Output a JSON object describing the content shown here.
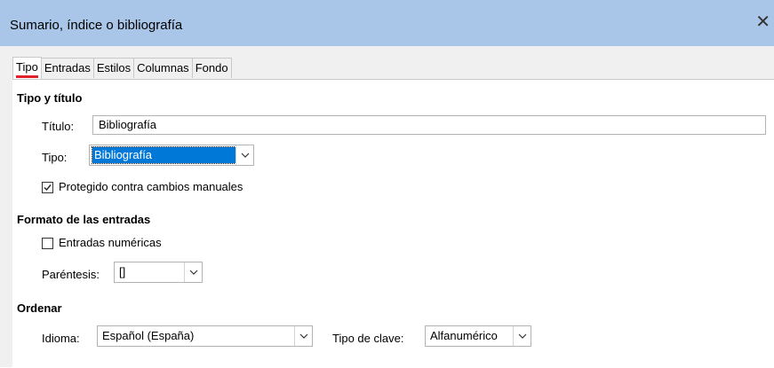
{
  "window": {
    "title": "Sumario, índice o bibliografía",
    "close_icon": "close-icon"
  },
  "tabs": [
    {
      "label": "Tipo",
      "active": true
    },
    {
      "label": "Entradas",
      "active": false
    },
    {
      "label": "Estilos",
      "active": false
    },
    {
      "label": "Columnas",
      "active": false
    },
    {
      "label": "Fondo",
      "active": false
    }
  ],
  "tipo_titulo": {
    "heading": "Tipo y título",
    "titulo_label": "Título:",
    "titulo_value": "Bibliografía",
    "tipo_label": "Tipo:",
    "tipo_value": "Bibliografía",
    "protegido_label": "Protegido contra cambios manuales",
    "protegido_checked": true
  },
  "formato": {
    "heading": "Formato de las entradas",
    "numericas_label": "Entradas numéricas",
    "numericas_checked": false,
    "parentesis_label": "Paréntesis:",
    "parentesis_value": "[]"
  },
  "ordenar": {
    "heading": "Ordenar",
    "idioma_label": "Idioma:",
    "idioma_value": "Español (España)",
    "clave_label": "Tipo de clave:",
    "clave_value": "Alfanumérico"
  },
  "colors": {
    "titlebar": "#a9c6e8",
    "dialog_bg": "#f0f0f0",
    "selection": "#0078d7",
    "active_tab_indicator": "#e0202a"
  }
}
